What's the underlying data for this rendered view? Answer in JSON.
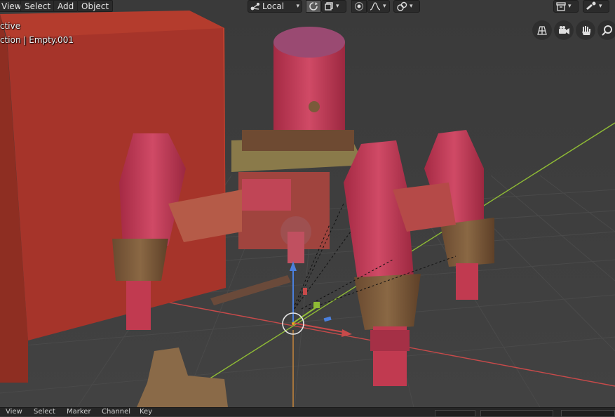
{
  "menu": {
    "view": "View",
    "select": "Select",
    "add": "Add",
    "object": "Object"
  },
  "header": {
    "transform_orientation": "Local"
  },
  "overlay": {
    "mode_line": "ctive",
    "object_line": "ction | Empty.001"
  },
  "status_bar": {
    "items": [
      "View",
      "Select",
      "Marker",
      "Channel",
      "Key"
    ]
  },
  "icons": {
    "orientation": "transform-orientation-icon",
    "pivot": "pivot-point-icon",
    "snap": "snap-icon",
    "proportional": "proportional-editing-icon",
    "falloff": "falloff-curve-icon",
    "visibility": "object-visibility-icon",
    "gizmo": "gizmo-icon",
    "grid": "grid-icon",
    "camera": "camera-icon",
    "hand": "hand-pan-icon",
    "zoom": "zoom-icon"
  },
  "colors": {
    "x_axis": "#c84a4a",
    "y_axis": "#8fbb35",
    "z_axis": "#4a7fdc",
    "model_red": "#b8374f",
    "panel": "#2b2b2b"
  }
}
